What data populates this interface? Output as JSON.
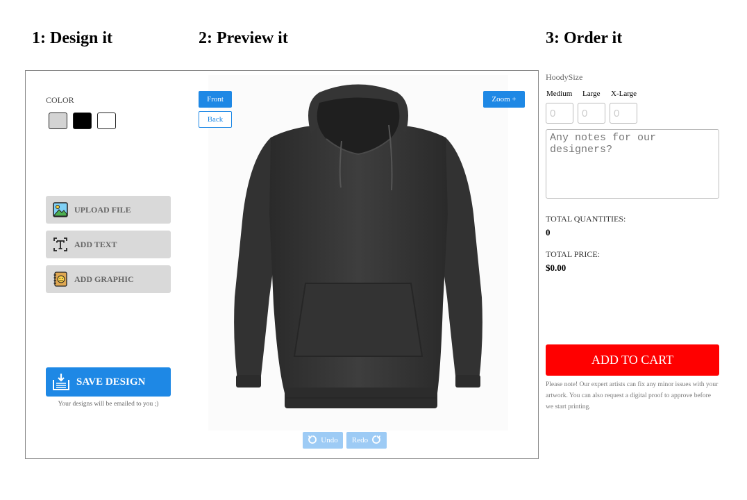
{
  "steps": {
    "design": "1: Design it",
    "preview": "2: Preview it",
    "order": "3: Order it"
  },
  "design": {
    "color_label": "COLOR",
    "colors": [
      {
        "name": "light-gray",
        "hex": "#d3d3d3"
      },
      {
        "name": "black",
        "hex": "#000000"
      },
      {
        "name": "white",
        "hex": "#ffffff"
      }
    ],
    "tools": [
      {
        "label": "UPLOAD FILE",
        "icon": "image-icon"
      },
      {
        "label": "ADD TEXT",
        "icon": "text-icon"
      },
      {
        "label": "ADD GRAPHIC",
        "icon": "smiley-notebook-icon"
      }
    ],
    "save_label": "SAVE DESIGN",
    "save_note": "Your designs will be emailed to you ;)"
  },
  "preview": {
    "front_label": "Front",
    "back_label": "Back",
    "zoom_label": "Zoom +",
    "undo_label": "Undo",
    "redo_label": "Redo",
    "product_color": "#3a3a3a"
  },
  "order": {
    "title": "HoodySize",
    "sizes": [
      {
        "label": "Medium",
        "placeholder": "0"
      },
      {
        "label": "Large",
        "placeholder": "0"
      },
      {
        "label": "X-Large",
        "placeholder": "0"
      }
    ],
    "notes_placeholder": "Any notes for our designers?",
    "total_quantities_label": "TOTAL QUANTITIES:",
    "total_quantities_value": "0",
    "total_price_label": "TOTAL PRICE:",
    "total_price_value": "$0.00",
    "add_to_cart_label": "ADD TO CART",
    "disclaimer": "Please note! Our expert artists can fix any minor issues with your artwork. You can also request a digital proof to approve before we start printing."
  },
  "colors": {
    "accent": "#1e88e5",
    "accent_disabled": "#9dcbf5",
    "cart": "#ff0000",
    "tool_bg": "#d9d9d9"
  }
}
